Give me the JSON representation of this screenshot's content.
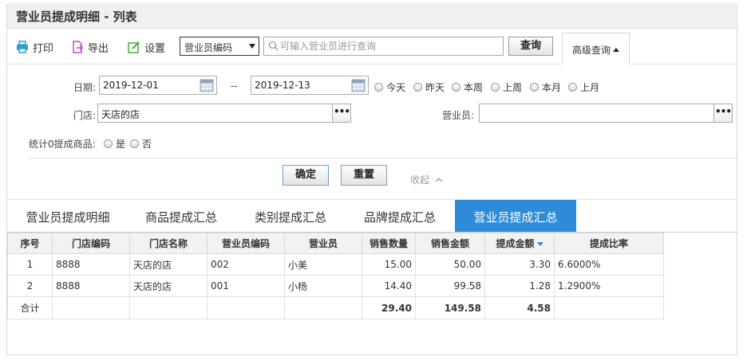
{
  "page_title": "营业员提成明细 - 列表",
  "toolbar": {
    "print_label": "打印",
    "export_label": "导出",
    "settings_label": "设置",
    "search_field_select": "营业员编码",
    "search_placeholder": "可输入营业员进行查询",
    "query_label": "查询",
    "advanced_query_label": "高级查询"
  },
  "filters": {
    "date_label": "日期:",
    "date_from": "2019-12-01",
    "date_separator": "--",
    "date_to": "2019-12-13",
    "quick_dates": [
      "今天",
      "昨天",
      "本周",
      "上周",
      "本月",
      "上月"
    ],
    "store_label": "门店:",
    "store_value": "天店的店",
    "clerk_label": "营业员:",
    "clerk_value": "",
    "zero_label": "统计0提成商品:",
    "zero_options": [
      "是",
      "否"
    ],
    "confirm_label": "确定",
    "reset_label": "重置",
    "collapse_label": "收起"
  },
  "tabs": [
    {
      "label": "营业员提成明细",
      "active": false
    },
    {
      "label": "商品提成汇总",
      "active": false
    },
    {
      "label": "类别提成汇总",
      "active": false
    },
    {
      "label": "品牌提成汇总",
      "active": false
    },
    {
      "label": "营业员提成汇总",
      "active": true
    }
  ],
  "table": {
    "columns": [
      "序号",
      "门店编码",
      "门店名称",
      "营业员编码",
      "营业员",
      "销售数量",
      "销售金额",
      "提成金额",
      "提成比率"
    ],
    "rows": [
      [
        "1",
        "8888",
        "天店的店",
        "002",
        "小美",
        "15.00",
        "50.00",
        "3.30",
        "6.6000%"
      ],
      [
        "2",
        "8888",
        "天店的店",
        "001",
        "小杨",
        "14.40",
        "99.58",
        "1.28",
        "1.2900%"
      ]
    ],
    "total": [
      "合计",
      "",
      "",
      "",
      "",
      "29.40",
      "149.58",
      "4.58",
      ""
    ]
  },
  "colors": {
    "accent": "#2d8bd8",
    "print_icon": "#2a9fd6",
    "export_icon": "#c04ac8",
    "settings_icon": "#4caa3c"
  }
}
